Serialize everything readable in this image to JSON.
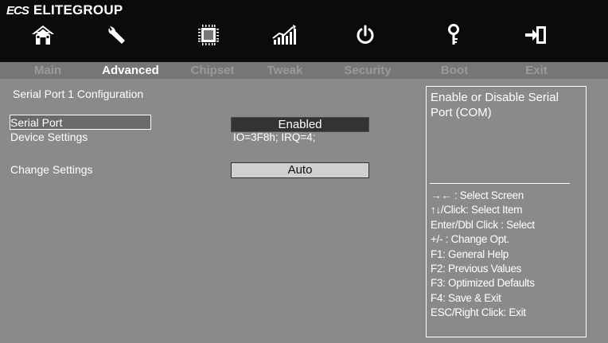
{
  "brand": {
    "logo_text": "ECS",
    "name": "ELITEGROUP"
  },
  "toolbar_icons": [
    "home-icon",
    "wrench-icon",
    "chip-icon",
    "chart-icon",
    "power-icon",
    "key-icon",
    "exit-icon"
  ],
  "tabs": [
    {
      "label": "Main",
      "active": false
    },
    {
      "label": "Advanced",
      "active": true
    },
    {
      "label": "Chipset",
      "active": false
    },
    {
      "label": "Tweak",
      "active": false
    },
    {
      "label": "Security",
      "active": false
    },
    {
      "label": "Boot",
      "active": false
    },
    {
      "label": "Exit",
      "active": false
    }
  ],
  "main": {
    "section_title": "Serial Port 1 Configuration",
    "rows": {
      "serial_port": {
        "label": "Serial Port",
        "value": "Enabled"
      },
      "device_settings": {
        "label": "Device Settings",
        "value": "IO=3F8h; IRQ=4;"
      },
      "change_settings": {
        "label": "Change Settings",
        "value": "Auto"
      }
    }
  },
  "help": {
    "description": "Enable or Disable Serial Port (COM)",
    "keys": [
      "→← : Select Screen",
      "↑↓/Click: Select Item",
      "Enter/Dbl Click : Select",
      "+/- : Change Opt.",
      "F1: General Help",
      "F2: Previous Values",
      "F3: Optimized Defaults",
      "F4: Save & Exit",
      "ESC/Right Click: Exit"
    ]
  },
  "colors": {
    "background": "#8a8a8a",
    "topbar": "#0b0b0b",
    "tabbar": "#767676",
    "enabled_field": "#333333",
    "auto_field": "#d0d0d0"
  }
}
